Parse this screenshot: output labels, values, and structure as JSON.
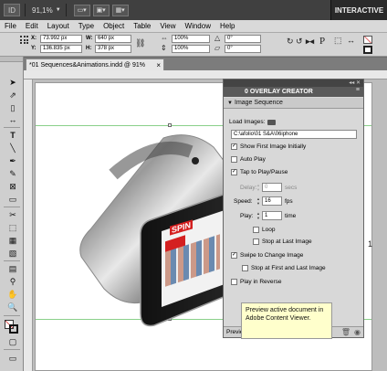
{
  "appbar": {
    "logo": "ID",
    "zoom": "91,1%",
    "workspace": "INTERACTIVE"
  },
  "menubar": [
    "File",
    "Edit",
    "Layout",
    "Type",
    "Object",
    "Table",
    "View",
    "Window",
    "Help"
  ],
  "control": {
    "x_label": "X:",
    "x_value": "73.992 px",
    "y_label": "Y:",
    "y_value": "136.835 px",
    "w_label": "W:",
    "w_value": "640 px",
    "h_label": "H:",
    "h_value": "378 px",
    "scale_x": "100%",
    "scale_y": "100%",
    "rotate": "0°",
    "shear": "0°"
  },
  "document_tab": {
    "title": "*01 Sequences&Animations.indd @ 91%",
    "close": "×"
  },
  "canvas": {
    "page_number": "1"
  },
  "panel": {
    "collapse": "◂◂ ✕",
    "title": "0 OVERLAY CREATOR",
    "menu_icon": "≡",
    "section": "Image Sequence",
    "load_images_label": "Load Images:",
    "path_value": "C:\\afolio\\01 S&A\\06iphone",
    "options": {
      "show_first": "Show First Image Initially",
      "auto_play": "Auto Play",
      "tap_to_play": "Tap to Play/Pause",
      "delay_label": "Delay:",
      "delay_value": "0",
      "delay_unit": "secs",
      "speed_label": "Speed:",
      "speed_value": "16",
      "speed_unit": "fps",
      "play_label": "Play:",
      "play_value": "1",
      "play_unit": "time",
      "loop": "Loop",
      "stop_last": "Stop at Last Image",
      "swipe": "Swipe to Change Image",
      "stop_first_last": "Stop at First and Last Image",
      "play_reverse": "Play in Reverse"
    },
    "bottom_label": "Preview"
  },
  "tooltip": {
    "text": "Preview active document in Adobe Content Viewer."
  },
  "artwork": {
    "magazine": "SPIN"
  },
  "colors": {
    "appbar": "#404040",
    "panel_tab": "#5a5a5a",
    "tooltip_bg": "#ffffcc",
    "guide": "#8ad08a",
    "spin_red": "#d42020"
  }
}
